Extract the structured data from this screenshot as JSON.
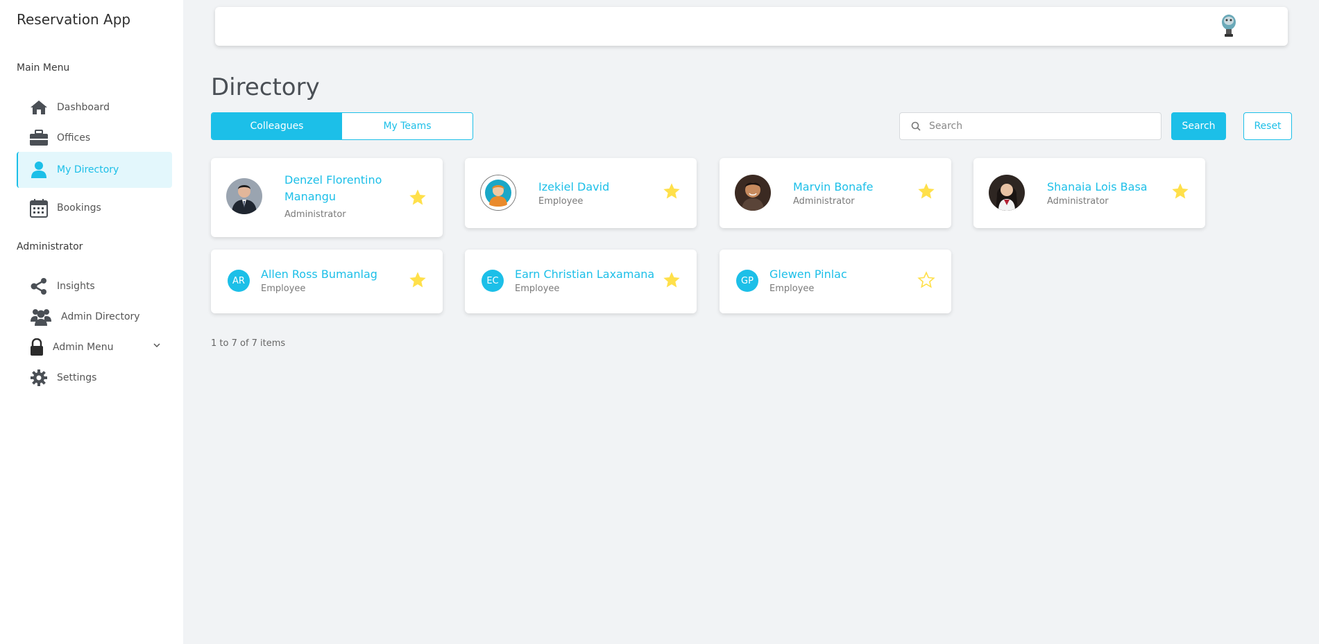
{
  "app": {
    "title": "Reservation App"
  },
  "sidebar": {
    "main_menu_label": "Main Menu",
    "main_items": [
      {
        "label": "Dashboard",
        "icon": "home-icon"
      },
      {
        "label": "Offices",
        "icon": "briefcase-icon"
      },
      {
        "label": "My Directory",
        "icon": "user-icon",
        "active": true
      },
      {
        "label": "Bookings",
        "icon": "calendar-icon"
      }
    ],
    "admin_label": "Administrator",
    "admin_items": [
      {
        "label": "Insights",
        "icon": "share-icon"
      },
      {
        "label": "Admin Directory",
        "icon": "users-icon"
      },
      {
        "label": "Admin Menu",
        "icon": "lock-icon",
        "has_dropdown": true
      },
      {
        "label": "Settings",
        "icon": "gear-icon"
      }
    ]
  },
  "page": {
    "title": "Directory",
    "tabs": [
      {
        "label": "Colleagues",
        "active": true
      },
      {
        "label": "My Teams",
        "active": false
      }
    ],
    "search": {
      "placeholder": "Search",
      "value": ""
    },
    "search_button": "Search",
    "reset_button": "Reset",
    "pager_text": "1 to 7 of 7 items"
  },
  "colleagues": [
    {
      "name": "Denzel Florentino Manangu",
      "role": "Administrator",
      "avatar": "photo",
      "favorite": true
    },
    {
      "name": "Izekiel David",
      "role": "Employee",
      "avatar": "illustration",
      "favorite": true
    },
    {
      "name": "Marvin Bonafe",
      "role": "Administrator",
      "avatar": "photo",
      "favorite": true
    },
    {
      "name": "Shanaia Lois Basa",
      "role": "Administrator",
      "avatar": "photo",
      "favorite": true
    },
    {
      "name": "Allen Ross Bumanlag",
      "role": "Employee",
      "initials": "AR",
      "favorite": true
    },
    {
      "name": "Earn Christian Laxamana",
      "role": "Employee",
      "initials": "EC",
      "favorite": true
    },
    {
      "name": "Glewen Pinlac",
      "role": "Employee",
      "initials": "GP",
      "favorite": false
    }
  ],
  "colors": {
    "accent": "#1cbfe8",
    "star": "#ffe04a",
    "background": "#f1f3f5"
  }
}
